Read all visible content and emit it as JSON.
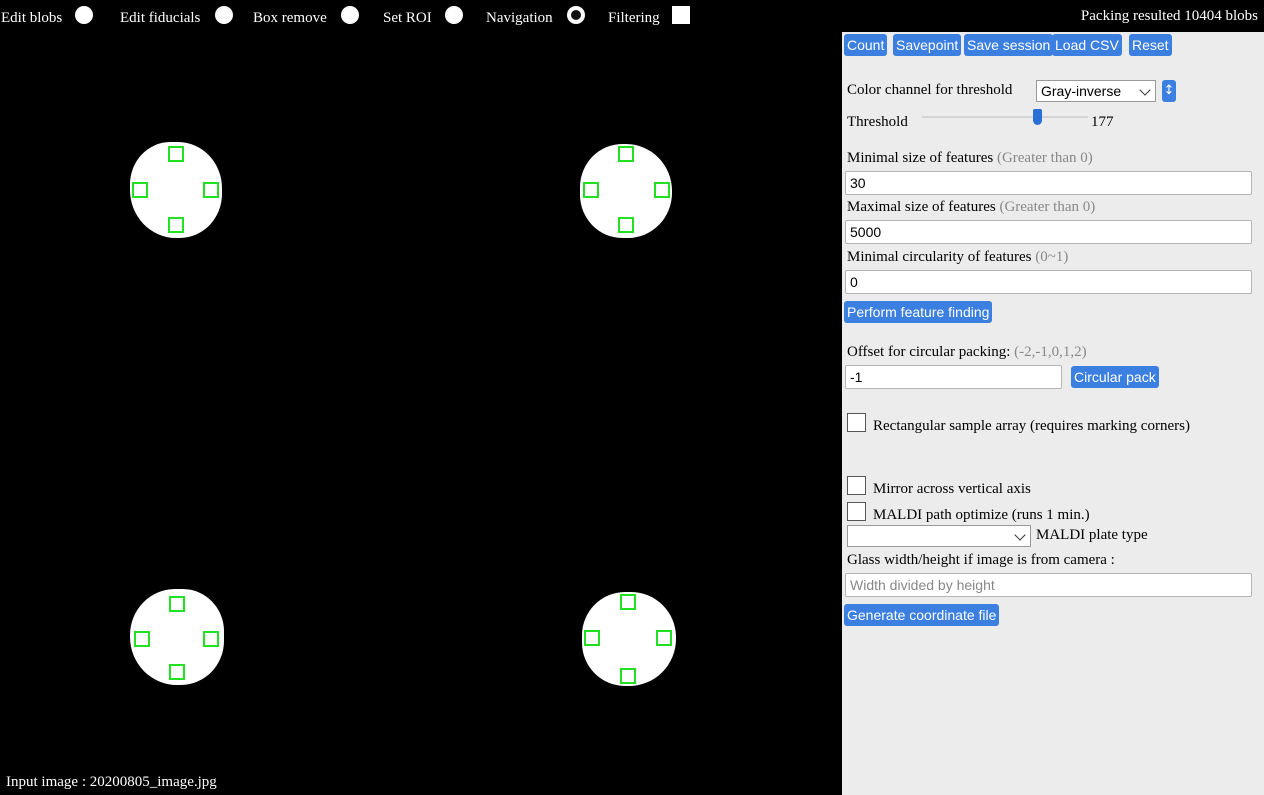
{
  "modes": [
    {
      "label": "Edit blobs",
      "checked": false
    },
    {
      "label": "Edit fiducials",
      "checked": false
    },
    {
      "label": "Box remove",
      "checked": false
    },
    {
      "label": "Set ROI",
      "checked": false
    },
    {
      "label": "Navigation",
      "checked": true
    }
  ],
  "filtering": {
    "label": "Filtering",
    "checked": false
  },
  "status": {
    "packing": "Packing resulted 10404 blobs"
  },
  "toolbar": {
    "count": "Count",
    "savepoint": "Savepoint",
    "save_session": "Save session",
    "load_csv": "Load CSV",
    "reset": "Reset"
  },
  "threshold": {
    "channel_label": "Color channel for threshold",
    "channel_value": "Gray-inverse",
    "label": "Threshold",
    "value": "177",
    "fraction": 0.69
  },
  "features": {
    "min_size_label": "Minimal size of features",
    "min_size_hint": "(Greater than 0)",
    "min_size_value": "30",
    "max_size_label": "Maximal size of features",
    "max_size_hint": "(Greater than 0)",
    "max_size_value": "5000",
    "circularity_label": "Minimal circularity of features",
    "circularity_hint": "(0~1)",
    "circularity_value": "0",
    "perform_button": "Perform feature finding"
  },
  "packing": {
    "offset_label": "Offset for circular packing:",
    "offset_hint": "(-2,-1,0,1,2)",
    "offset_value": "-1",
    "circular_pack_button": "Circular pack"
  },
  "options": {
    "rect_array_label": "Rectangular sample array (requires marking corners)",
    "mirror_label": "Mirror across vertical axis",
    "maldi_optimize_label": "MALDI path optimize (runs 1 min.)",
    "maldi_plate_label": "MALDI plate type",
    "maldi_plate_value": ""
  },
  "glass": {
    "label": "Glass width/height if image is from camera :",
    "placeholder": "Width divided by height"
  },
  "generate_button": "Generate coordinate file",
  "footer": {
    "input_image": "Input image : 20200805_image.jpg"
  },
  "colors": {
    "accent": "#3b7fe0",
    "fiducial": "#22e022",
    "panel_bg": "#ececec"
  },
  "icons": {
    "swap": "swap-vertical-icon",
    "dropdown": "chevron-down-icon"
  }
}
